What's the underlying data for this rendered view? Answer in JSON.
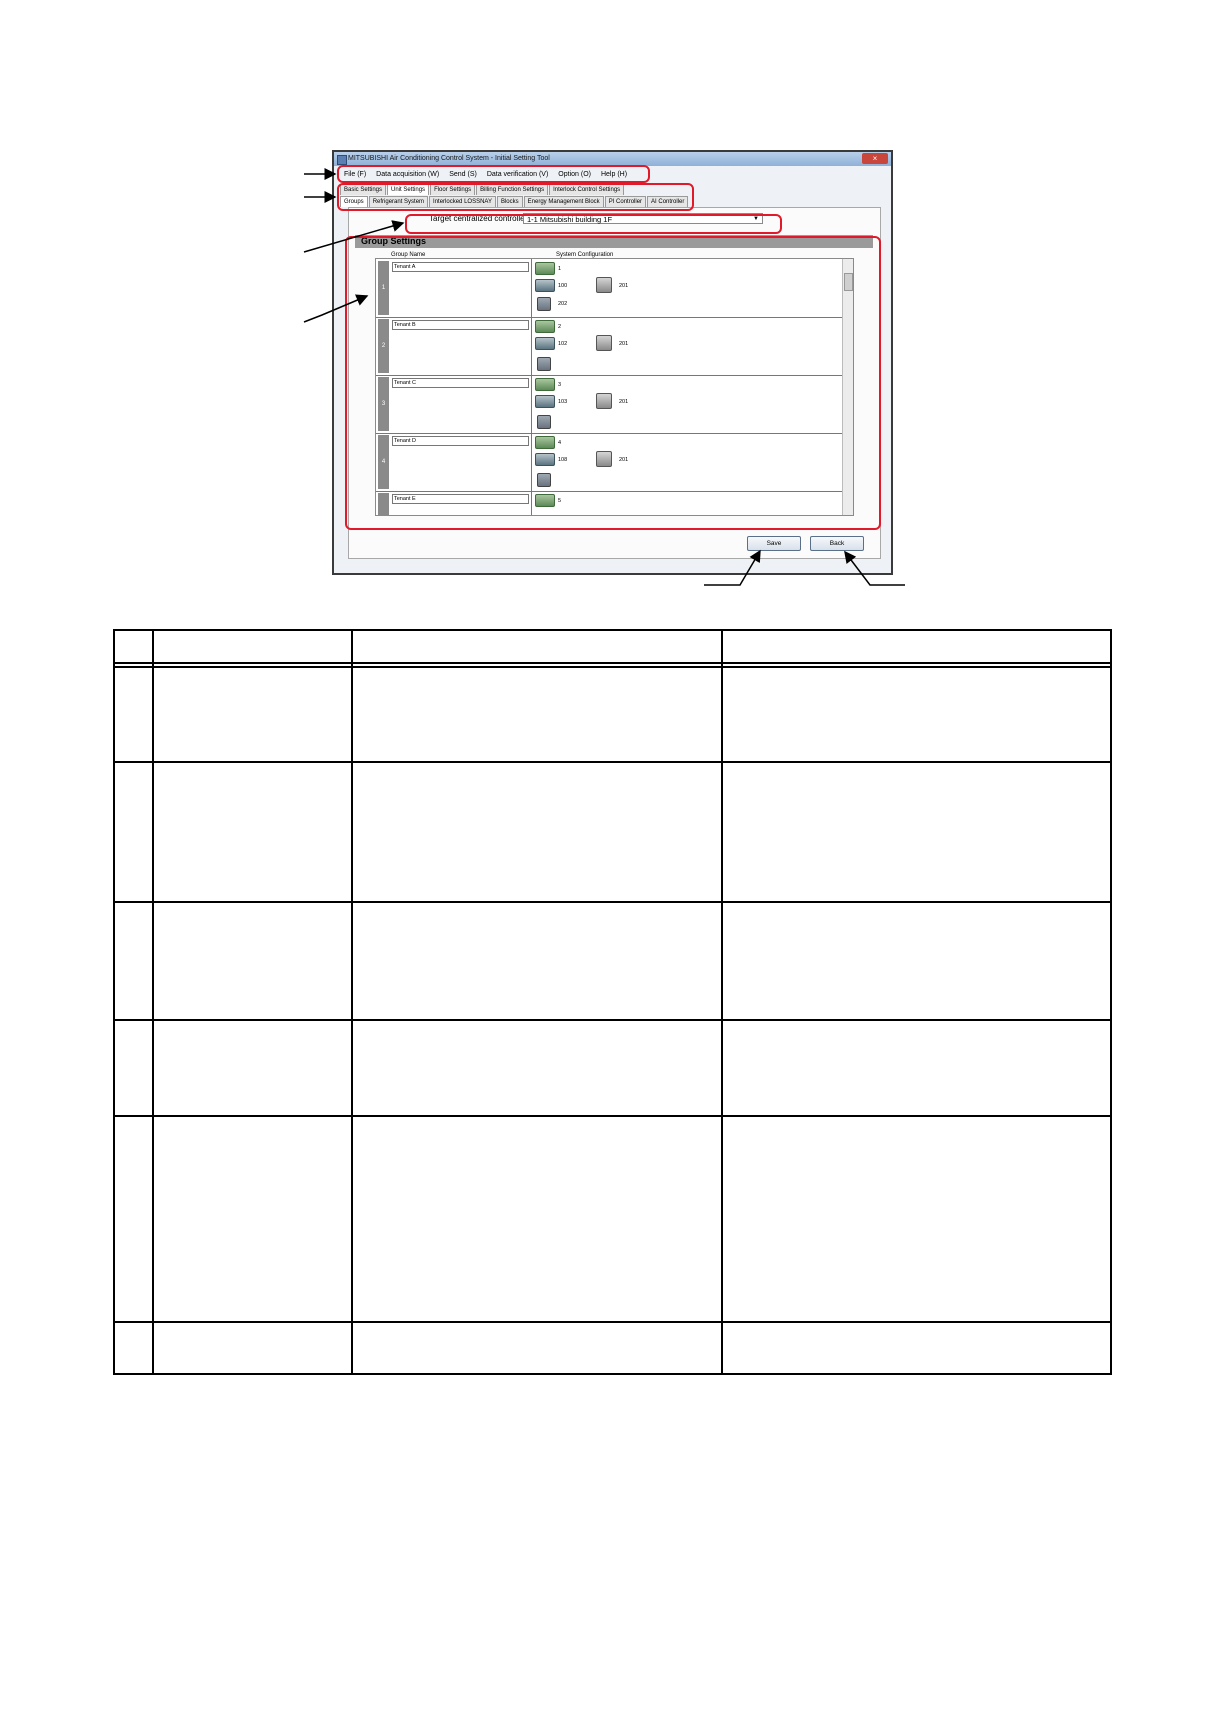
{
  "window": {
    "title": "MITSUBISHI Air Conditioning Control System - Initial Setting Tool",
    "close_glyph": "×"
  },
  "menu": [
    "File (F)",
    "Data acquisition (W)",
    "Send (S)",
    "Data verification (V)",
    "Option (O)",
    "Help (H)"
  ],
  "tabs_top": [
    "Basic Settings",
    "Unit Settings",
    "Floor Settings",
    "Billing Function Settings",
    "Interlock Control Settings"
  ],
  "tabs_sub": [
    "Groups",
    "Refrigerant System",
    "Interlocked LOSSNAY",
    "Blocks",
    "Energy Management Block",
    "PI Controller",
    "AI Controller"
  ],
  "target": {
    "label": "Target centralized controller",
    "value": "1-1  Mitsubishi building 1F"
  },
  "panel": {
    "title": "Group Settings",
    "col_group_name": "Group Name",
    "col_system_config": "System Configuration"
  },
  "groups": [
    {
      "num": "1",
      "name": "Tenant A",
      "units": [
        "1",
        "100",
        "201",
        "202"
      ]
    },
    {
      "num": "2",
      "name": "Tenant B",
      "units": [
        "2",
        "102",
        "201"
      ]
    },
    {
      "num": "3",
      "name": "Tenant C",
      "units": [
        "3",
        "103",
        "201"
      ]
    },
    {
      "num": "4",
      "name": "Tenant D",
      "units": [
        "4",
        "108",
        "201"
      ]
    },
    {
      "num": "5",
      "name": "Tenant E",
      "units": [
        "5"
      ]
    }
  ],
  "buttons": {
    "save": "Save",
    "back": "Back"
  },
  "icons": [
    "outdoor-unit-icon",
    "indoor-unit-icon",
    "remote-controller-icon",
    "sensor-icon"
  ],
  "colors": {
    "highlight": "#e01a2a",
    "panel_header": "#9a9a9a"
  }
}
